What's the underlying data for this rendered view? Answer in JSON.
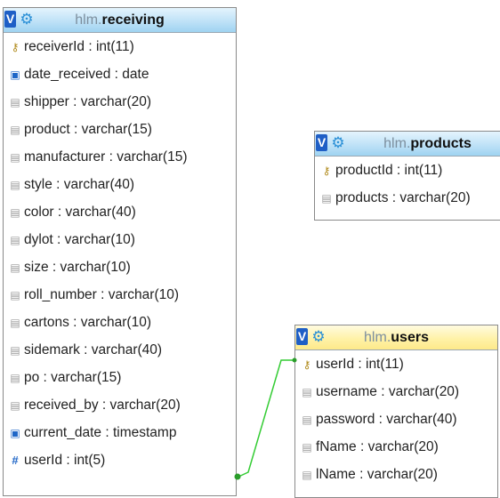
{
  "tables": {
    "receiving": {
      "schema": "hlm.",
      "name": "receiving",
      "columns": [
        {
          "icon": "primary-key-icon",
          "text": "receiverId : int(11)"
        },
        {
          "icon": "date-icon",
          "text": "date_received : date"
        },
        {
          "icon": "column-icon",
          "text": "shipper : varchar(20)"
        },
        {
          "icon": "column-icon",
          "text": "product : varchar(15)"
        },
        {
          "icon": "column-icon",
          "text": "manufacturer : varchar(15)"
        },
        {
          "icon": "column-icon",
          "text": "style : varchar(40)"
        },
        {
          "icon": "column-icon",
          "text": "color : varchar(40)"
        },
        {
          "icon": "column-icon",
          "text": "dylot : varchar(10)"
        },
        {
          "icon": "column-icon",
          "text": "size : varchar(10)"
        },
        {
          "icon": "column-icon",
          "text": "roll_number : varchar(10)"
        },
        {
          "icon": "column-icon",
          "text": "cartons : varchar(10)"
        },
        {
          "icon": "column-icon",
          "text": "sidemark : varchar(40)"
        },
        {
          "icon": "column-icon",
          "text": "po : varchar(15)"
        },
        {
          "icon": "column-icon",
          "text": "received_by : varchar(20)"
        },
        {
          "icon": "date-icon",
          "text": "current_date : timestamp"
        },
        {
          "icon": "numeric-icon",
          "text": "userId : int(5)"
        }
      ]
    },
    "products": {
      "schema": "hlm.",
      "name": "products",
      "columns": [
        {
          "icon": "primary-key-icon",
          "text": "productId : int(11)"
        },
        {
          "icon": "column-icon",
          "text": "products : varchar(20)"
        }
      ]
    },
    "users": {
      "schema": "hlm.",
      "name": "users",
      "columns": [
        {
          "icon": "primary-key-icon",
          "text": "userId : int(11)"
        },
        {
          "icon": "column-icon",
          "text": "username : varchar(20)"
        },
        {
          "icon": "column-icon",
          "text": "password : varchar(40)"
        },
        {
          "icon": "column-icon",
          "text": "fName : varchar(20)"
        },
        {
          "icon": "column-icon",
          "text": "lName : varchar(20)"
        }
      ]
    }
  },
  "header_icons": {
    "view": "V",
    "options": "gear-icon"
  },
  "colors": {
    "header_blue": "#bfe2f7",
    "header_yellow": "#fff2a8",
    "relation_line": "#33cc33",
    "view_badge": "#1f5fc6"
  }
}
